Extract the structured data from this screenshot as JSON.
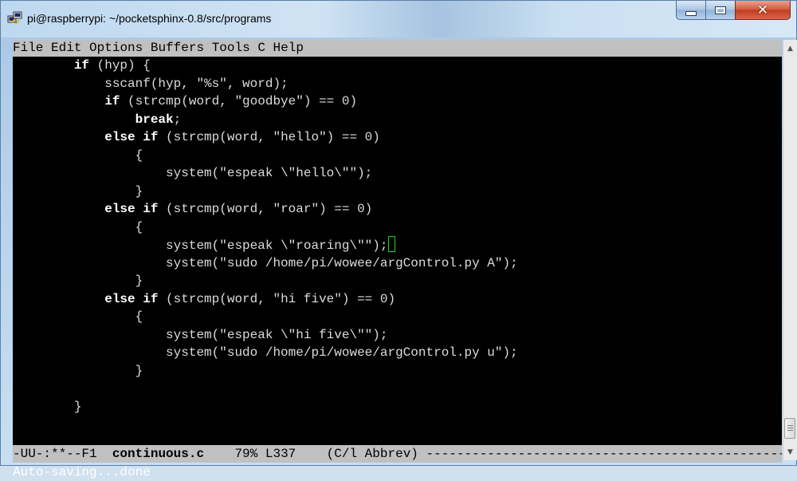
{
  "window": {
    "title": "pi@raspberrypi: ~/pocketsphinx-0.8/src/programs"
  },
  "menu": {
    "items": [
      "File",
      "Edit",
      "Options",
      "Buffers",
      "Tools",
      "C",
      "Help"
    ]
  },
  "code_lines": [
    [
      {
        "t": "        "
      },
      {
        "t": "if",
        "k": true
      },
      {
        "t": " (hyp) {"
      }
    ],
    [
      {
        "t": "            sscanf(hyp, \"%s\", word);"
      }
    ],
    [
      {
        "t": "            "
      },
      {
        "t": "if",
        "k": true
      },
      {
        "t": " (strcmp(word, \"goodbye\") == 0)"
      }
    ],
    [
      {
        "t": "                "
      },
      {
        "t": "break",
        "k": true
      },
      {
        "t": ";"
      }
    ],
    [
      {
        "t": "            "
      },
      {
        "t": "else",
        "k": true
      },
      {
        "t": " "
      },
      {
        "t": "if",
        "k": true
      },
      {
        "t": " (strcmp(word, \"hello\") == 0)"
      }
    ],
    [
      {
        "t": "                {"
      }
    ],
    [
      {
        "t": "                    system(\"espeak \\\"hello\\\"\");"
      }
    ],
    [
      {
        "t": "                }"
      }
    ],
    [
      {
        "t": "            "
      },
      {
        "t": "else",
        "k": true
      },
      {
        "t": " "
      },
      {
        "t": "if",
        "k": true
      },
      {
        "t": " (strcmp(word, \"roar\") == 0)"
      }
    ],
    [
      {
        "t": "                {"
      }
    ],
    [
      {
        "t": "                    system(\"espeak \\\"roaring\\\"\");"
      },
      {
        "cursor": true
      }
    ],
    [
      {
        "t": "                    system(\"sudo /home/pi/wowee/argControl.py A\");"
      }
    ],
    [
      {
        "t": "                }"
      }
    ],
    [
      {
        "t": "            "
      },
      {
        "t": "else",
        "k": true
      },
      {
        "t": " "
      },
      {
        "t": "if",
        "k": true
      },
      {
        "t": " (strcmp(word, \"hi five\") == 0)"
      }
    ],
    [
      {
        "t": "                {"
      }
    ],
    [
      {
        "t": "                    system(\"espeak \\\"hi five\\\"\");"
      }
    ],
    [
      {
        "t": "                    system(\"sudo /home/pi/wowee/argControl.py u\");"
      }
    ],
    [
      {
        "t": "                }"
      }
    ],
    [
      {
        "t": ""
      }
    ],
    [
      {
        "t": "        }"
      }
    ]
  ],
  "modeline": {
    "prefix": "-UU-:**--F1  ",
    "buffer": "continuous.c",
    "rest": "    79% L337    (C/l Abbrev) ------------------------------------------------"
  },
  "echo_area": "Auto-saving...done",
  "colors": {
    "terminal_bg": "#000000",
    "code_fg": "#dcdcdc",
    "bar_bg": "#c0c0c0",
    "cursor": "#1ed12a"
  },
  "icons": {
    "app": "putty-icon",
    "minimize": "minimize-icon",
    "maximize": "maximize-icon",
    "close": "close-icon"
  }
}
